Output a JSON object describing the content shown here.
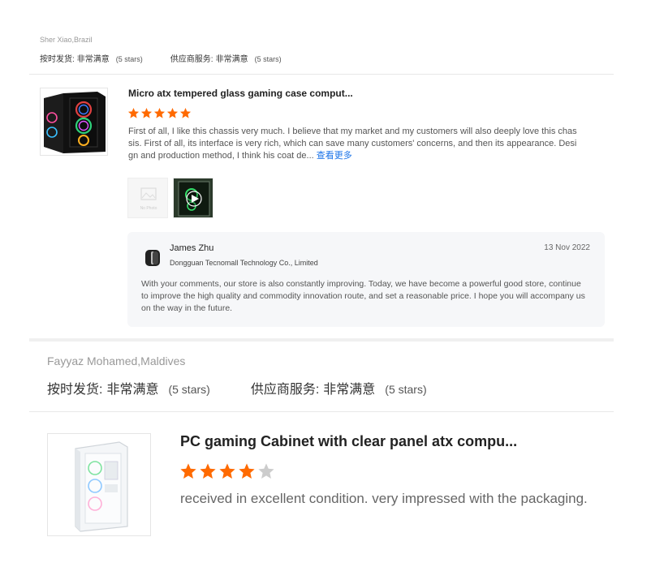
{
  "reviews": [
    {
      "buyer": "Sher Xiao,Brazil",
      "ratings": [
        {
          "label": "按时发货:",
          "value": "非常满意",
          "stars_text": "(5 stars)"
        },
        {
          "label": "供应商服务:",
          "value": "非常满意",
          "stars_text": "(5 stars)"
        }
      ],
      "product_title": "Micro atx tempered glass gaming case comput...",
      "product_image_icon": "gaming-case-image",
      "star_rating": 5,
      "text": "First of all, I like this chassis very much. I believe that my market and my customers will also deeply love this chassis. First of all, its interface is very rich, which can save many customers' concerns, and then its appearance. Design and production method, I think his coat de...",
      "more_link": "查看更多",
      "images": [
        {
          "icon": "image-placeholder-icon",
          "caption": "No Photo"
        },
        {
          "icon": "video-thumbnail"
        }
      ],
      "reply": {
        "name": "James Zhu",
        "company": "Dongguan Tecnomall Technology Co., Limited",
        "date": "13 Nov 2022",
        "text": "With your comments, our store is also constantly improving. Today, we have become a powerful good store, continue to improve the high quality and commodity innovation route, and set a reasonable price. I hope you will accompany us on the way in the future."
      }
    },
    {
      "buyer": "Fayyaz Mohamed,Maldives",
      "ratings": [
        {
          "label": "按时发货:",
          "value": "非常满意",
          "stars_text": "(5 stars)"
        },
        {
          "label": "供应商服务:",
          "value": "非常满意",
          "stars_text": "(5 stars)"
        }
      ],
      "product_title": "PC gaming Cabinet with clear panel atx compu...",
      "product_image_icon": "white-pc-case-image",
      "star_rating": 4,
      "text": "received in excellent condition. very impressed with the packaging."
    }
  ],
  "colors": {
    "star_filled": "#ff6a00",
    "star_empty": "#cccccc",
    "link": "#1a73e8",
    "reply_bg": "#f6f7f9"
  }
}
